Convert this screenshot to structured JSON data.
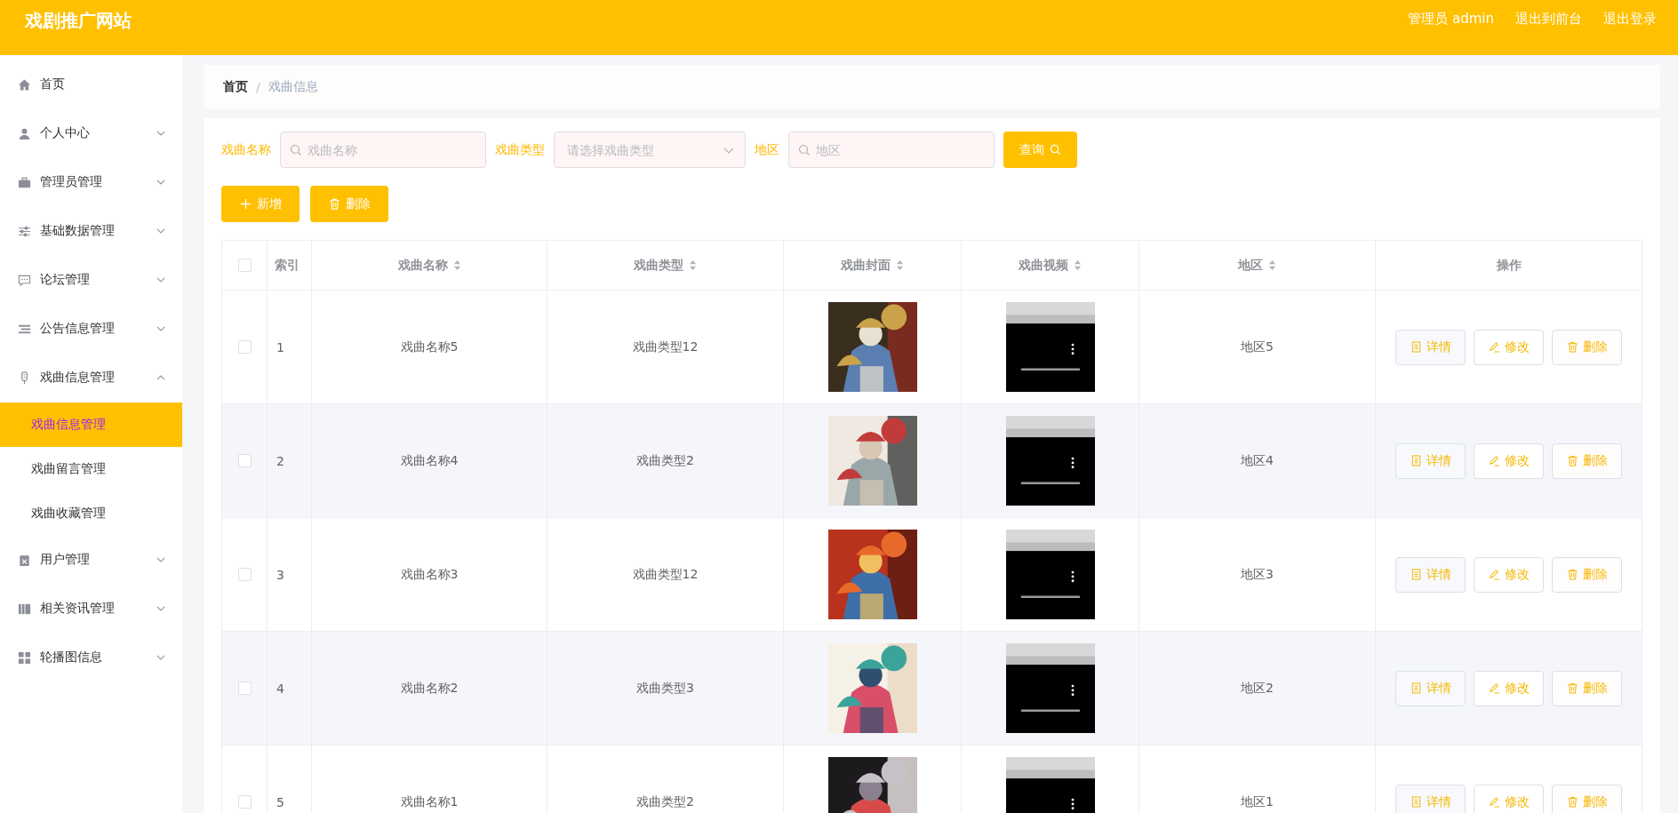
{
  "header": {
    "title": "戏剧推广网站",
    "links": [
      "管理员 admin",
      "退出到前台",
      "退出登录"
    ]
  },
  "sidebar": {
    "items": [
      {
        "label": "首页",
        "kind": "home"
      },
      {
        "label": "个人中心",
        "kind": "user",
        "expanded": false
      },
      {
        "label": "管理员管理",
        "kind": "briefcase",
        "expanded": false
      },
      {
        "label": "基础数据管理",
        "kind": "sliders",
        "expanded": false
      },
      {
        "label": "论坛管理",
        "kind": "chat",
        "expanded": false
      },
      {
        "label": "公告信息管理",
        "kind": "list",
        "expanded": false
      },
      {
        "label": "戏曲信息管理",
        "kind": "mic",
        "expanded": true,
        "children": [
          {
            "label": "戏曲信息管理",
            "selected": true
          },
          {
            "label": "戏曲留言管理",
            "selected": false
          },
          {
            "label": "戏曲收藏管理",
            "selected": false
          }
        ]
      },
      {
        "label": "用户管理",
        "kind": "clipboard",
        "expanded": false
      },
      {
        "label": "相关资讯管理",
        "kind": "book",
        "expanded": false
      },
      {
        "label": "轮播图信息",
        "kind": "grid",
        "expanded": false
      }
    ]
  },
  "breadcrumb": {
    "items": [
      "首页",
      "戏曲信息"
    ],
    "separator": "/"
  },
  "search": {
    "fields": [
      {
        "label": "戏曲名称",
        "kind": "text",
        "placeholder": "戏曲名称"
      },
      {
        "label": "戏曲类型",
        "kind": "select",
        "placeholder": "请选择戏曲类型"
      },
      {
        "label": "地区",
        "kind": "text",
        "placeholder": "地区"
      }
    ],
    "button": "查询"
  },
  "actions": [
    {
      "label": "新增",
      "kind": "add"
    },
    {
      "label": "删除",
      "kind": "delete"
    }
  ],
  "table": {
    "select_all_checked": false,
    "columns": [
      {
        "label": "索引",
        "kind": "plain"
      },
      {
        "label": "戏曲名称",
        "kind": "sortable"
      },
      {
        "label": "戏曲类型",
        "kind": "sortable"
      },
      {
        "label": "戏曲封面",
        "kind": "sortable"
      },
      {
        "label": "戏曲视频",
        "kind": "sortable"
      },
      {
        "label": "地区",
        "kind": "sortable"
      },
      {
        "label": "操作",
        "kind": "plain"
      }
    ],
    "rows": [
      {
        "checked": false,
        "index": "1",
        "name": "戏曲名称5",
        "type": "戏曲类型12",
        "region": "地区5",
        "buttons": [
          {
            "label": "详情",
            "kind": "detail"
          },
          {
            "label": "修改",
            "kind": "edit"
          },
          {
            "label": "删除",
            "kind": "delete"
          }
        ]
      },
      {
        "checked": false,
        "index": "2",
        "name": "戏曲名称4",
        "type": "戏曲类型2",
        "region": "地区4",
        "buttons": [
          {
            "label": "详情",
            "kind": "detail"
          },
          {
            "label": "修改",
            "kind": "edit"
          },
          {
            "label": "删除",
            "kind": "delete"
          }
        ]
      },
      {
        "checked": false,
        "index": "3",
        "name": "戏曲名称3",
        "type": "戏曲类型12",
        "region": "地区3",
        "buttons": [
          {
            "label": "详情",
            "kind": "detail"
          },
          {
            "label": "修改",
            "kind": "edit"
          },
          {
            "label": "删除",
            "kind": "delete"
          }
        ]
      },
      {
        "checked": false,
        "index": "4",
        "name": "戏曲名称2",
        "type": "戏曲类型3",
        "region": "地区2",
        "buttons": [
          {
            "label": "详情",
            "kind": "detail"
          },
          {
            "label": "修改",
            "kind": "edit"
          },
          {
            "label": "删除",
            "kind": "delete"
          }
        ]
      },
      {
        "checked": false,
        "index": "5",
        "name": "戏曲名称1",
        "type": "戏曲类型2",
        "region": "地区1",
        "buttons": [
          {
            "label": "详情",
            "kind": "detail"
          },
          {
            "label": "修改",
            "kind": "edit"
          },
          {
            "label": "删除",
            "kind": "delete"
          }
        ]
      }
    ]
  }
}
